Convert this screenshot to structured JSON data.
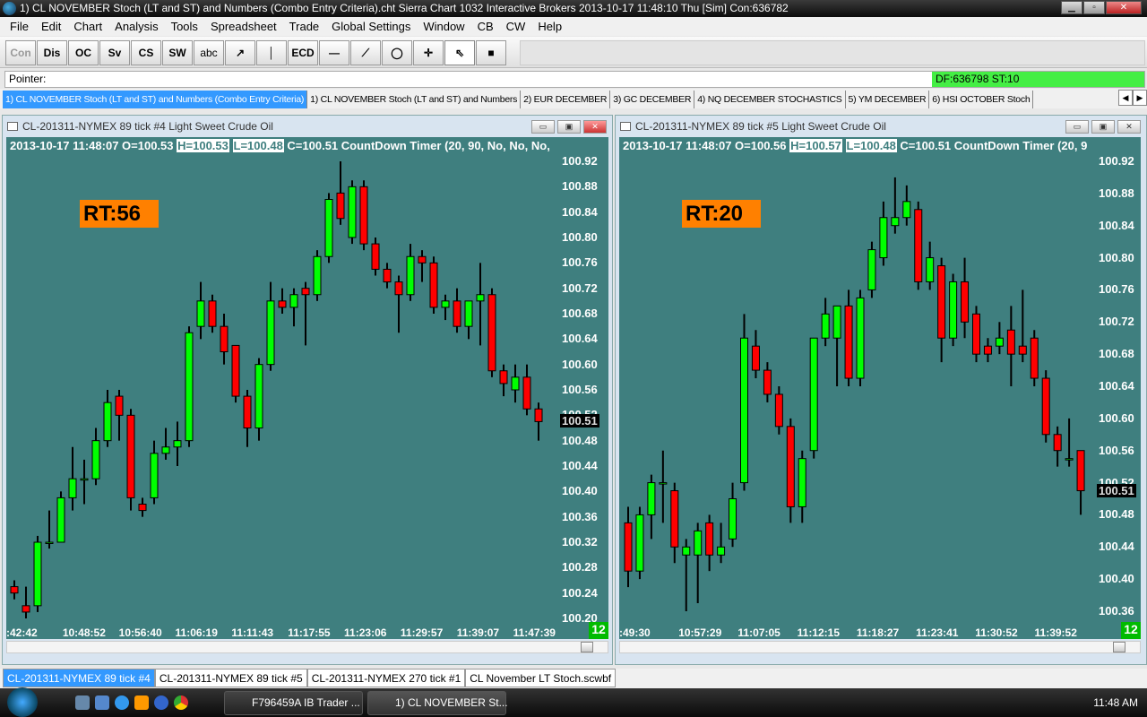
{
  "window": {
    "title": "1) CL NOVEMBER Stoch (LT and ST) and Numbers (Combo Entry Criteria).cht  Sierra Chart 1032 Interactive Brokers 2013-10-17  11:48:10 Thu [Sim]  Con:636782"
  },
  "menu": [
    "File",
    "Edit",
    "Chart",
    "Analysis",
    "Tools",
    "Spreadsheet",
    "Trade",
    "Global Settings",
    "Window",
    "CB",
    "CW",
    "Help"
  ],
  "toolbar": [
    "Con",
    "Dis",
    "OC",
    "Sv",
    "CS",
    "SW",
    "abc",
    "↗",
    "│",
    "ECD",
    "—",
    "⟋",
    "◯",
    "✛",
    "⇖",
    "■"
  ],
  "status": {
    "pointer": "Pointer:",
    "df": "DF:636798  ST:10"
  },
  "tabs": [
    "1) CL NOVEMBER Stoch (LT and ST) and Numbers (Combo Entry Criteria)",
    "1) CL NOVEMBER Stoch (LT and ST) and Numbers",
    "2) EUR DECEMBER",
    "3) GC DECEMBER",
    "4) NQ DECEMBER STOCHASTICS",
    "5) YM DECEMBER",
    "6) HSI OCTOBER Stoch"
  ],
  "colors": {
    "bg": "#3f7f7f",
    "up": "#00ff00",
    "down": "#ff0000",
    "rt": "#ff8000"
  },
  "charts": [
    {
      "title": "CL-201311-NYMEX  89 tick  #4  Light Sweet Crude Oil",
      "hdr_a": "2013-10-17 11:48:07 O=100.53 ",
      "hdr_h": "H=100.53",
      "hdr_l": "L=100.48",
      "hdr_b": " C=100.51  CountDown Timer   (20, 90, No, No, No,",
      "rt": "RT:56",
      "current": "100.51",
      "count": "12",
      "yticks": [
        "100.92",
        "100.88",
        "100.84",
        "100.80",
        "100.76",
        "100.72",
        "100.68",
        "100.64",
        "100.60",
        "100.56",
        "100.52",
        "100.48",
        "100.44",
        "100.40",
        "100.36",
        "100.32",
        "100.28",
        "100.24",
        "100.20"
      ],
      "xticks": [
        ":42:42",
        "10:48:52",
        "10:56:40",
        "11:06:19",
        "11:11:43",
        "11:17:55",
        "11:23:06",
        "11:29:57",
        "11:39:07",
        "11:47:39"
      ],
      "ylim": [
        100.2,
        100.92
      ],
      "ohlc": [
        [
          100.25,
          100.26,
          100.23,
          100.24
        ],
        [
          100.22,
          100.25,
          100.2,
          100.21
        ],
        [
          100.22,
          100.33,
          100.21,
          100.32
        ],
        [
          100.32,
          100.37,
          100.31,
          100.32
        ],
        [
          100.32,
          100.4,
          100.32,
          100.39
        ],
        [
          100.39,
          100.47,
          100.37,
          100.42
        ],
        [
          100.42,
          100.45,
          100.38,
          100.42
        ],
        [
          100.42,
          100.5,
          100.41,
          100.48
        ],
        [
          100.48,
          100.56,
          100.47,
          100.54
        ],
        [
          100.55,
          100.56,
          100.48,
          100.52
        ],
        [
          100.52,
          100.53,
          100.37,
          100.39
        ],
        [
          100.38,
          100.39,
          100.36,
          100.37
        ],
        [
          100.39,
          100.48,
          100.38,
          100.46
        ],
        [
          100.46,
          100.5,
          100.45,
          100.47
        ],
        [
          100.47,
          100.51,
          100.44,
          100.48
        ],
        [
          100.48,
          100.66,
          100.47,
          100.65
        ],
        [
          100.66,
          100.73,
          100.64,
          100.7
        ],
        [
          100.7,
          100.71,
          100.65,
          100.66
        ],
        [
          100.66,
          100.68,
          100.6,
          100.62
        ],
        [
          100.63,
          100.63,
          100.54,
          100.55
        ],
        [
          100.55,
          100.56,
          100.47,
          100.5
        ],
        [
          100.5,
          100.61,
          100.48,
          100.6
        ],
        [
          100.6,
          100.73,
          100.59,
          100.7
        ],
        [
          100.7,
          100.72,
          100.68,
          100.69
        ],
        [
          100.69,
          100.72,
          100.66,
          100.71
        ],
        [
          100.72,
          100.73,
          100.63,
          100.71
        ],
        [
          100.71,
          100.78,
          100.7,
          100.77
        ],
        [
          100.77,
          100.87,
          100.76,
          100.86
        ],
        [
          100.87,
          100.92,
          100.82,
          100.83
        ],
        [
          100.8,
          100.89,
          100.79,
          100.88
        ],
        [
          100.88,
          100.89,
          100.78,
          100.79
        ],
        [
          100.79,
          100.8,
          100.74,
          100.75
        ],
        [
          100.75,
          100.76,
          100.72,
          100.73
        ],
        [
          100.73,
          100.74,
          100.65,
          100.71
        ],
        [
          100.71,
          100.79,
          100.7,
          100.77
        ],
        [
          100.77,
          100.78,
          100.73,
          100.76
        ],
        [
          100.76,
          100.77,
          100.68,
          100.69
        ],
        [
          100.69,
          100.71,
          100.67,
          100.7
        ],
        [
          100.7,
          100.72,
          100.65,
          100.66
        ],
        [
          100.66,
          100.7,
          100.64,
          100.7
        ],
        [
          100.7,
          100.76,
          100.63,
          100.71
        ],
        [
          100.71,
          100.72,
          100.58,
          100.59
        ],
        [
          100.59,
          100.6,
          100.55,
          100.57
        ],
        [
          100.56,
          100.6,
          100.54,
          100.58
        ],
        [
          100.58,
          100.6,
          100.52,
          100.53
        ],
        [
          100.53,
          100.54,
          100.48,
          100.51
        ]
      ]
    },
    {
      "title": "CL-201311-NYMEX  89 tick  #5  Light Sweet Crude Oil",
      "hdr_a": "2013-10-17 11:48:07 O=100.56 ",
      "hdr_h": "H=100.57",
      "hdr_l": "L=100.48",
      "hdr_b": " C=100.51  CountDown Timer   (20, 9",
      "rt": "RT:20",
      "current": "100.51",
      "count": "12",
      "yticks": [
        "100.92",
        "100.88",
        "100.84",
        "100.80",
        "100.76",
        "100.72",
        "100.68",
        "100.64",
        "100.60",
        "100.56",
        "100.52",
        "100.48",
        "100.44",
        "100.40",
        "100.36"
      ],
      "xticks": [
        ":49:30",
        "10:57:29",
        "11:07:05",
        "11:12:15",
        "11:18:27",
        "11:23:41",
        "11:30:52",
        "11:39:52"
      ],
      "ylim": [
        100.36,
        100.92
      ],
      "ohlc": [
        [
          100.47,
          100.49,
          100.39,
          100.41
        ],
        [
          100.41,
          100.49,
          100.4,
          100.48
        ],
        [
          100.48,
          100.53,
          100.45,
          100.52
        ],
        [
          100.52,
          100.56,
          100.47,
          100.52
        ],
        [
          100.51,
          100.52,
          100.42,
          100.44
        ],
        [
          100.43,
          100.45,
          100.36,
          100.44
        ],
        [
          100.43,
          100.47,
          100.37,
          100.46
        ],
        [
          100.47,
          100.48,
          100.41,
          100.43
        ],
        [
          100.43,
          100.47,
          100.42,
          100.44
        ],
        [
          100.45,
          100.52,
          100.44,
          100.5
        ],
        [
          100.52,
          100.73,
          100.51,
          100.7
        ],
        [
          100.69,
          100.71,
          100.65,
          100.66
        ],
        [
          100.66,
          100.67,
          100.62,
          100.63
        ],
        [
          100.63,
          100.64,
          100.58,
          100.59
        ],
        [
          100.59,
          100.6,
          100.47,
          100.49
        ],
        [
          100.49,
          100.56,
          100.47,
          100.55
        ],
        [
          100.56,
          100.7,
          100.55,
          100.7
        ],
        [
          100.7,
          100.75,
          100.69,
          100.73
        ],
        [
          100.7,
          100.74,
          100.64,
          100.74
        ],
        [
          100.74,
          100.76,
          100.64,
          100.65
        ],
        [
          100.65,
          100.76,
          100.64,
          100.75
        ],
        [
          100.76,
          100.82,
          100.75,
          100.81
        ],
        [
          100.8,
          100.87,
          100.79,
          100.85
        ],
        [
          100.84,
          100.9,
          100.83,
          100.85
        ],
        [
          100.85,
          100.89,
          100.84,
          100.87
        ],
        [
          100.86,
          100.87,
          100.76,
          100.77
        ],
        [
          100.77,
          100.82,
          100.76,
          100.8
        ],
        [
          100.79,
          100.8,
          100.67,
          100.7
        ],
        [
          100.7,
          100.78,
          100.69,
          100.77
        ],
        [
          100.77,
          100.8,
          100.7,
          100.72
        ],
        [
          100.73,
          100.74,
          100.67,
          100.68
        ],
        [
          100.69,
          100.7,
          100.67,
          100.68
        ],
        [
          100.69,
          100.72,
          100.68,
          100.7
        ],
        [
          100.71,
          100.74,
          100.64,
          100.68
        ],
        [
          100.69,
          100.76,
          100.67,
          100.68
        ],
        [
          100.7,
          100.71,
          100.64,
          100.65
        ],
        [
          100.65,
          100.66,
          100.57,
          100.58
        ],
        [
          100.58,
          100.59,
          100.54,
          100.56
        ],
        [
          100.55,
          100.6,
          100.54,
          100.55
        ],
        [
          100.56,
          100.56,
          100.48,
          100.51
        ]
      ]
    }
  ],
  "bottom_tabs": [
    "CL-201311-NYMEX  89 tick  #4",
    "CL-201311-NYMEX  89 tick  #5",
    "CL-201311-NYMEX  270 tick  #1",
    "CL November LT Stoch.scwbf"
  ],
  "taskbar": {
    "tasks": [
      "F796459A IB Trader ...",
      "1) CL NOVEMBER St..."
    ],
    "clock": "11:48 AM"
  }
}
